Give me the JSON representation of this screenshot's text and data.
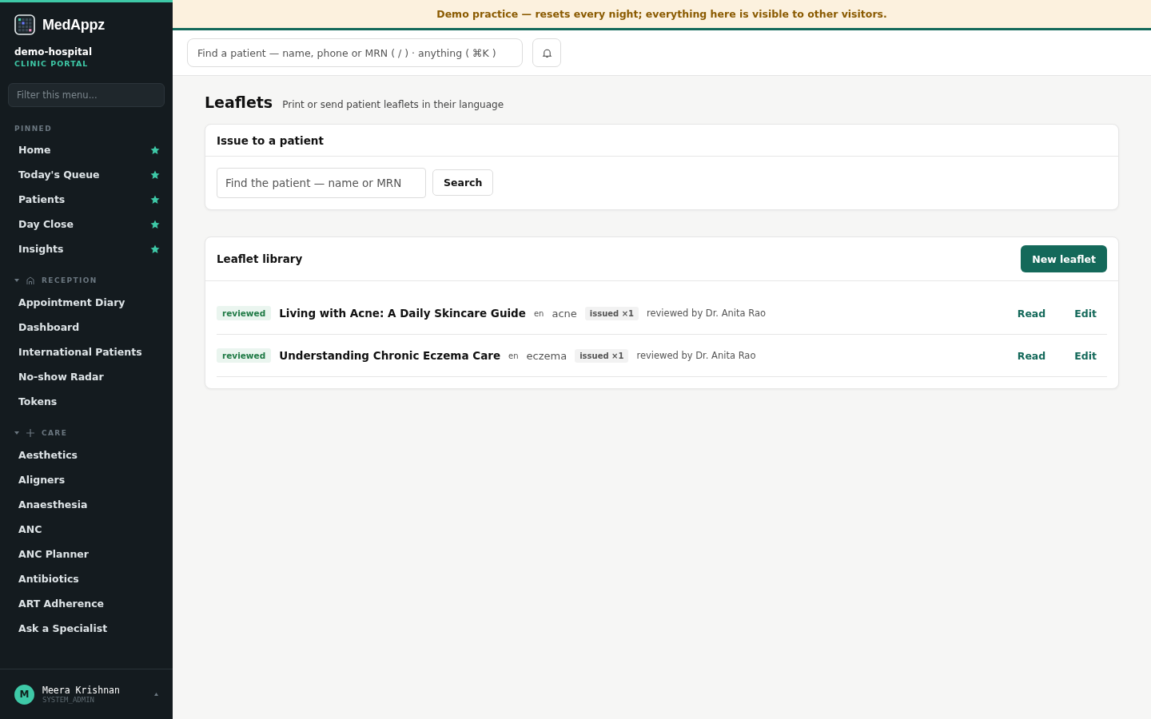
{
  "brand": {
    "name": "MedAppz",
    "org": "demo-hospital",
    "portal": "CLINIC PORTAL"
  },
  "sidebar": {
    "filter_placeholder": "Filter this menu...",
    "pinned": {
      "title": "PINNED",
      "items": [
        {
          "label": "Home",
          "starred": true
        },
        {
          "label": "Today's Queue",
          "starred": true
        },
        {
          "label": "Patients",
          "starred": true
        },
        {
          "label": "Day Close",
          "starred": true
        },
        {
          "label": "Insights",
          "starred": true
        }
      ]
    },
    "groups": [
      {
        "title": "RECEPTION",
        "kind": "home",
        "expanded": true,
        "items": [
          "Appointment Diary",
          "Dashboard",
          "International Patients",
          "No-show Radar",
          "Tokens"
        ]
      },
      {
        "title": "CARE",
        "kind": "plus",
        "expanded": true,
        "items": [
          "Aesthetics",
          "Aligners",
          "Anaesthesia",
          "ANC",
          "ANC Planner",
          "Antibiotics",
          "ART Adherence",
          "Ask a Specialist"
        ]
      }
    ],
    "user": {
      "initial": "M",
      "name": "Meera Krishnan",
      "role": "SYSTEM_ADMIN"
    }
  },
  "banner": "Demo practice — resets every night; everything here is visible to other visitors.",
  "topbar": {
    "search_placeholder": "Find a patient — name, phone or MRN ( / ) · anything ( ⌘K )"
  },
  "page": {
    "title": "Leaflets",
    "subtitle": "Print or send patient leaflets in their language"
  },
  "issue_card": {
    "title": "Issue to a patient",
    "search_placeholder": "Find the patient — name or MRN",
    "button": "Search"
  },
  "library": {
    "title": "Leaflet library",
    "new_button": "New leaflet",
    "rows": [
      {
        "status": "reviewed",
        "title": "Living with Acne: A Daily Skincare Guide",
        "lang": "en",
        "tag": "acne",
        "issued": "issued ×1",
        "reviewer": "reviewed by Dr. Anita Rao",
        "read": "Read",
        "edit": "Edit"
      },
      {
        "status": "reviewed",
        "title": "Understanding Chronic Eczema Care",
        "lang": "en",
        "tag": "eczema",
        "issued": "issued ×1",
        "reviewer": "reviewed by Dr. Anita Rao",
        "read": "Read",
        "edit": "Edit"
      }
    ]
  }
}
